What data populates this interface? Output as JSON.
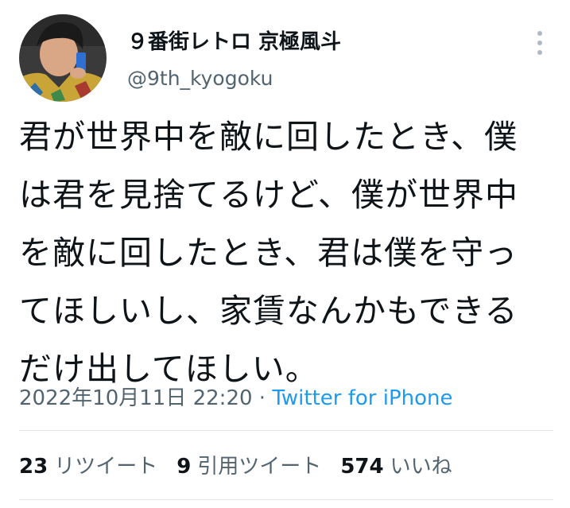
{
  "author": {
    "display_name": "９番街レトロ 京極風斗",
    "handle": "@9th_kyogoku",
    "avatar": "profile-photo"
  },
  "tweet": {
    "lines": [
      "君が世界中を敵に回したとき、僕",
      "は君を見捨てるけど、僕が世界中",
      "を敵に回したとき、君は僕を守っ",
      "てほしいし、家賃なんかもできる",
      "だけ出してほしい。"
    ],
    "timestamp": "2022年10月11日 22:20",
    "separator": "·",
    "source": "Twitter for iPhone"
  },
  "stats": {
    "retweets_count": "23",
    "retweets_label": "リツイート",
    "quotes_count": "9",
    "quotes_label": "引用ツイート",
    "likes_count": "574",
    "likes_label": "いいね"
  },
  "colors": {
    "text": "#0f1419",
    "secondary": "#536471",
    "link": "#1d9bf0"
  },
  "icons": {
    "more": "more-vertical-icon"
  }
}
